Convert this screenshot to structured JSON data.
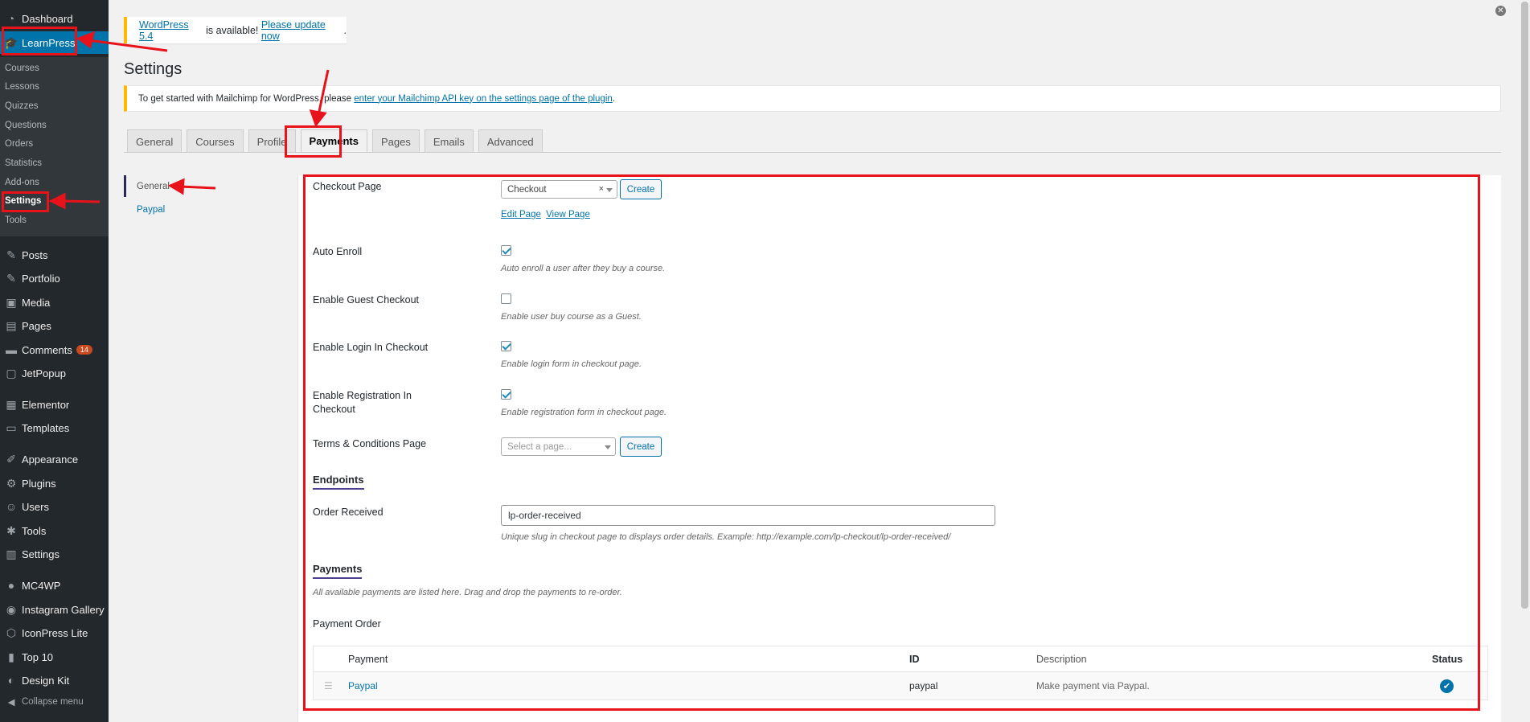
{
  "sidebar": {
    "items": [
      {
        "label": "Dashboard",
        "icon": "dashboard-icon",
        "glyph": "◔"
      },
      {
        "label": "LearnPress",
        "icon": "graduation-cap-icon",
        "glyph": "🎓"
      },
      {
        "label": "Posts",
        "icon": "pin-icon",
        "glyph": "✎"
      },
      {
        "label": "Portfolio",
        "icon": "pin-icon",
        "glyph": "✎"
      },
      {
        "label": "Media",
        "icon": "media-icon",
        "glyph": "▣"
      },
      {
        "label": "Pages",
        "icon": "pages-icon",
        "glyph": "▤"
      },
      {
        "label": "Comments",
        "icon": "comment-icon",
        "glyph": "▬",
        "badge": "14"
      },
      {
        "label": "JetPopup",
        "icon": "jetpopup-icon",
        "glyph": "▢"
      },
      {
        "label": "Elementor",
        "icon": "elementor-icon",
        "glyph": "▦"
      },
      {
        "label": "Templates",
        "icon": "folder-icon",
        "glyph": "▭"
      },
      {
        "label": "Appearance",
        "icon": "brush-icon",
        "glyph": "✐"
      },
      {
        "label": "Plugins",
        "icon": "plugin-icon",
        "glyph": "⚙"
      },
      {
        "label": "Users",
        "icon": "users-icon",
        "glyph": "☺"
      },
      {
        "label": "Tools",
        "icon": "wrench-icon",
        "glyph": "✱"
      },
      {
        "label": "Settings",
        "icon": "settings-icon",
        "glyph": "▥"
      },
      {
        "label": "MC4WP",
        "icon": "mc4wp-icon",
        "glyph": "●"
      },
      {
        "label": "Instagram Gallery",
        "icon": "instagram-icon",
        "glyph": "◉"
      },
      {
        "label": "IconPress Lite",
        "icon": "iconpress-icon",
        "glyph": "⬡"
      },
      {
        "label": "Top 10",
        "icon": "chart-icon",
        "glyph": "▮"
      },
      {
        "label": "Design Kit",
        "icon": "designkit-icon",
        "glyph": "◐"
      }
    ],
    "subitems": [
      "Courses",
      "Lessons",
      "Quizzes",
      "Questions",
      "Orders",
      "Statistics",
      "Add-ons",
      "Settings",
      "Tools"
    ],
    "collapse_label": "Collapse menu",
    "collapse_glyph": "◀"
  },
  "notices": {
    "update_link": "WordPress 5.4",
    "update_text": " is available! ",
    "update_now": "Please update now",
    "update_end": ".",
    "mailchimp_text": "To get started with Mailchimp for WordPress, please ",
    "mailchimp_link": "enter your Mailchimp API key on the settings page of the plugin",
    "mailchimp_end": "."
  },
  "page": {
    "title": "Settings",
    "close_glyph": "✕"
  },
  "tabs": [
    "General",
    "Courses",
    "Profile",
    "Payments",
    "Pages",
    "Emails",
    "Advanced"
  ],
  "subnav": [
    "General",
    "Paypal"
  ],
  "form": {
    "checkout_page_label": "Checkout Page",
    "checkout_page_value": "Checkout",
    "clear_glyph": "×",
    "create_label": "Create",
    "edit_page": "Edit Page",
    "view_page": "View Page",
    "auto_enroll_label": "Auto Enroll",
    "auto_enroll_desc": "Auto enroll a user after they buy a course.",
    "guest_label": "Enable Guest Checkout",
    "guest_desc": "Enable user buy course as a Guest.",
    "login_label": "Enable Login In Checkout",
    "login_desc": "Enable login form in checkout page.",
    "registration_label_1": "Enable Registration In",
    "registration_label_2": "Checkout",
    "registration_desc": "Enable registration form in checkout page.",
    "terms_label": "Terms & Conditions Page",
    "terms_placeholder": "Select a page...",
    "endpoints_title": "Endpoints",
    "order_received_label": "Order Received",
    "order_received_value": "lp-order-received",
    "order_received_desc": "Unique slug in checkout page to displays order details. Example: http://example.com/lp-checkout/lp-order-received/",
    "payments_title": "Payments",
    "payments_desc": "All available payments are listed here. Drag and drop the payments to re-order.",
    "payment_order_label": "Payment Order"
  },
  "payments_table": {
    "headers": {
      "payment": "Payment",
      "id": "ID",
      "description": "Description",
      "status": "Status"
    },
    "rows": [
      {
        "payment": "Paypal",
        "id": "paypal",
        "description": "Make payment via Paypal.",
        "status_glyph": "✔"
      }
    ],
    "drag_glyph": "☰"
  },
  "colors": {
    "accent": "#0073aa",
    "sidebar_bg": "#23282d",
    "notice_border": "#ffb900",
    "annotation": "#e8121a"
  }
}
